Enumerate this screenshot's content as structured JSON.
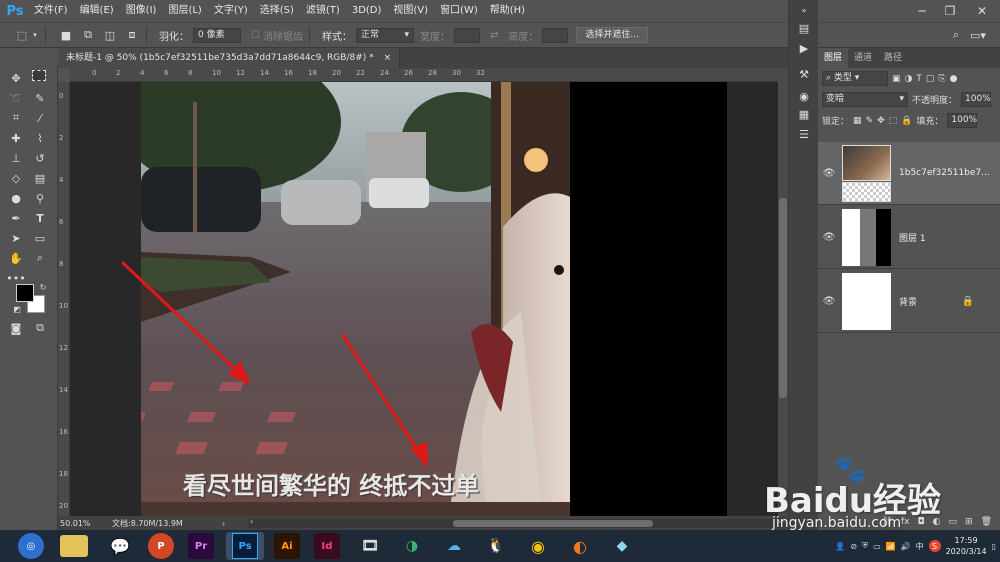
{
  "app": {
    "logo": "Ps"
  },
  "menu": [
    "文件(F)",
    "编辑(E)",
    "图像(I)",
    "图层(L)",
    "文字(Y)",
    "选择(S)",
    "滤镜(T)",
    "3D(D)",
    "视图(V)",
    "窗口(W)",
    "帮助(H)"
  ],
  "options": {
    "feather_label": "羽化：",
    "feather_value": "0 像素",
    "antialias_label": "消除锯齿",
    "style_label": "样式：",
    "style_value": "正常",
    "width_label": "宽度：",
    "height_label": "高度：",
    "select_mask_button": "选择并遮住..."
  },
  "document": {
    "tab_title": "未标题-1 @ 50% (1b5c7ef32511be735d3a7dd71a8644c9, RGB/8#) *",
    "close": "×",
    "subtitle_text": "看尽世间繁华的 终抵不过单"
  },
  "status": {
    "zoom": "50.01%",
    "doc_info": "文档:8.70M/13.9M"
  },
  "ruler_top": [
    "0",
    "2",
    "4",
    "6",
    "8",
    "10",
    "12",
    "14",
    "16",
    "18",
    "20",
    "22",
    "24",
    "26",
    "28",
    "30",
    "32"
  ],
  "ruler_left": [
    "0",
    "2",
    "4",
    "6",
    "8",
    "10",
    "12",
    "14",
    "16",
    "18",
    "20"
  ],
  "layers_panel": {
    "tabs": [
      "图层",
      "通道",
      "路径"
    ],
    "filter_kind": "类型",
    "blend_mode": "变暗",
    "opacity_label": "不透明度：",
    "opacity_value": "100%",
    "lock_label": "锁定：",
    "fill_label": "填充：",
    "fill_value": "100%",
    "layers": [
      {
        "name": "1b5c7ef32511be7...",
        "selected": true
      },
      {
        "name": "图层 1",
        "selected": false
      },
      {
        "name": "背景",
        "selected": false,
        "locked": true
      }
    ]
  },
  "taskbar": {
    "apps": [
      "browser",
      "files",
      "wechat",
      "powerpoint",
      "premiere",
      "photoshop",
      "illustrator",
      "indesign",
      "video",
      "360",
      "assistant",
      "qq",
      "chrome",
      "player",
      "camera"
    ],
    "app_labels": {
      "powerpoint": "P",
      "premiere": "Pr",
      "photoshop": "Ps",
      "illustrator": "Ai",
      "indesign": "Id"
    },
    "time": "17:59",
    "date": "2020/3/14",
    "tray_app": "S"
  },
  "watermark": {
    "brand": "Baidu经验",
    "url": "jingyan.baidu.com"
  },
  "colors": {
    "ps_blue": "#31a8ff",
    "arrow_red": "#e01818",
    "panel_bg": "#535353"
  }
}
